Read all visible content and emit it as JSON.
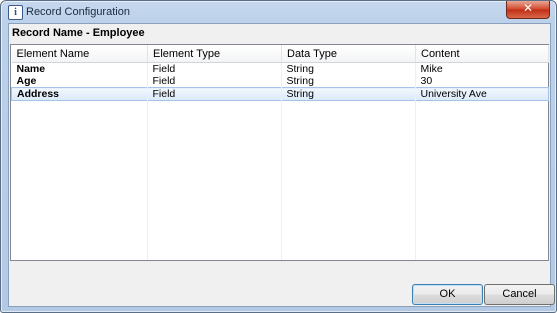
{
  "window": {
    "title": "Record Configuration",
    "close_glyph": "✕"
  },
  "record_name": "Record Name - Employee",
  "table": {
    "columns": [
      "Element Name",
      "Element Type",
      "Data Type",
      "Content"
    ],
    "rows": [
      [
        "Name",
        "Field",
        "String",
        "Mike"
      ],
      [
        "Age",
        "Field",
        "String",
        "30"
      ],
      [
        "Address",
        "Field",
        "String",
        "University Ave"
      ]
    ],
    "selected_row": 2
  },
  "buttons": {
    "ok": "OK",
    "cancel": "Cancel"
  }
}
